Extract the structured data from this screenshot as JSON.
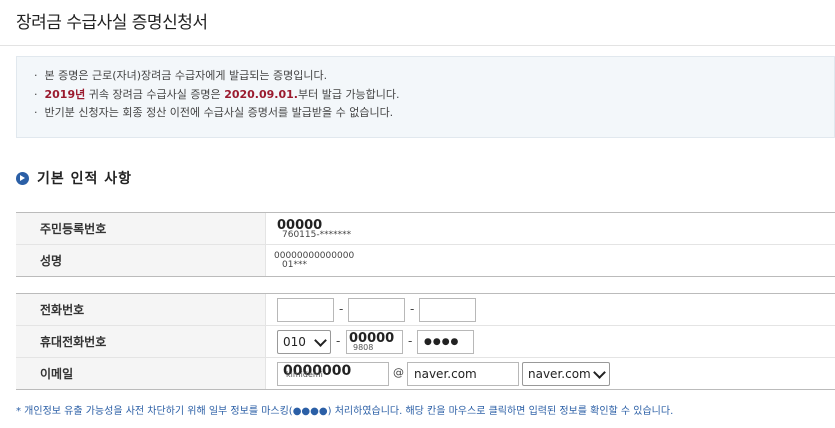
{
  "page": {
    "title": "장려금 수급사실 증명신청서"
  },
  "notice": {
    "line1": "본 증명은 근로(자녀)장려금 수급자에게 발급되는 증명입니다.",
    "line2_year": "2019년",
    "line2_mid": " 귀속 장려금 수급사실 증명은 ",
    "line2_date": "2020.09.01.",
    "line2_end": "부터 발급 가능합니다.",
    "line3": "반기분 신청자는 회종 정산 이전에 수급사실 증명서를 발급받을 수 없습니다."
  },
  "section": {
    "title": "기본 인적 사항"
  },
  "basic": {
    "rrn_label": "주민등록번호",
    "rrn_mask_big": "00000",
    "rrn_mask_small": "760115-*******",
    "name_label": "성명",
    "name_mask_line1": "00000000000000",
    "name_mask_line2": "01***"
  },
  "contact": {
    "phone_label": "전화번호",
    "mobile_label": "휴대전화번호",
    "mobile_prefix": "010",
    "mobile_mid_mask": "00000",
    "mobile_mid_small": "9808",
    "mobile_last": "●●●●",
    "email_label": "이메일",
    "email_id_mask": "0000000",
    "email_id_small": "kimidemi",
    "email_at": "@",
    "email_domain": "naver.com",
    "email_domain_select": "naver.com",
    "dash": "-"
  },
  "footnote": "* 개인정보 유출 가능성을 사전 차단하기 위해 일부 정보를 마스킹(●●●●) 처리하였습니다. 해당 칸을 마우스로 클릭하면 입력된 정보를 확인할 수 있습니다."
}
